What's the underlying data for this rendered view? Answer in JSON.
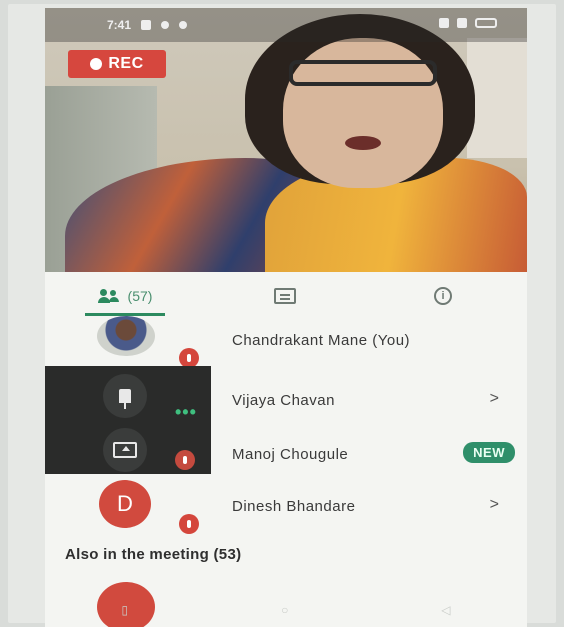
{
  "colors": {
    "accent_green": "#2c8a5f",
    "record_red": "#d6473e",
    "new_badge": "#2f8f6a",
    "avatar_red": "#d14a3e"
  },
  "status_bar": {
    "time": "7:41"
  },
  "video": {
    "rec_label": "REC"
  },
  "tabs": {
    "people_count": "(57)",
    "icons": [
      "people-icon",
      "chat-icon",
      "info-icon"
    ]
  },
  "participants": [
    {
      "name": "Chandrakant Mane (You)",
      "avatar": "photo",
      "muted": true
    },
    {
      "name": "Vijaya Chavan",
      "chevron": ">"
    },
    {
      "name": "Manoj Chougule",
      "badge": "NEW"
    },
    {
      "name": "Dinesh Bhandare",
      "avatar_letter": "D",
      "muted": true,
      "chevron": ">"
    }
  ],
  "also_in_meeting": "Also in the meeting (53)"
}
